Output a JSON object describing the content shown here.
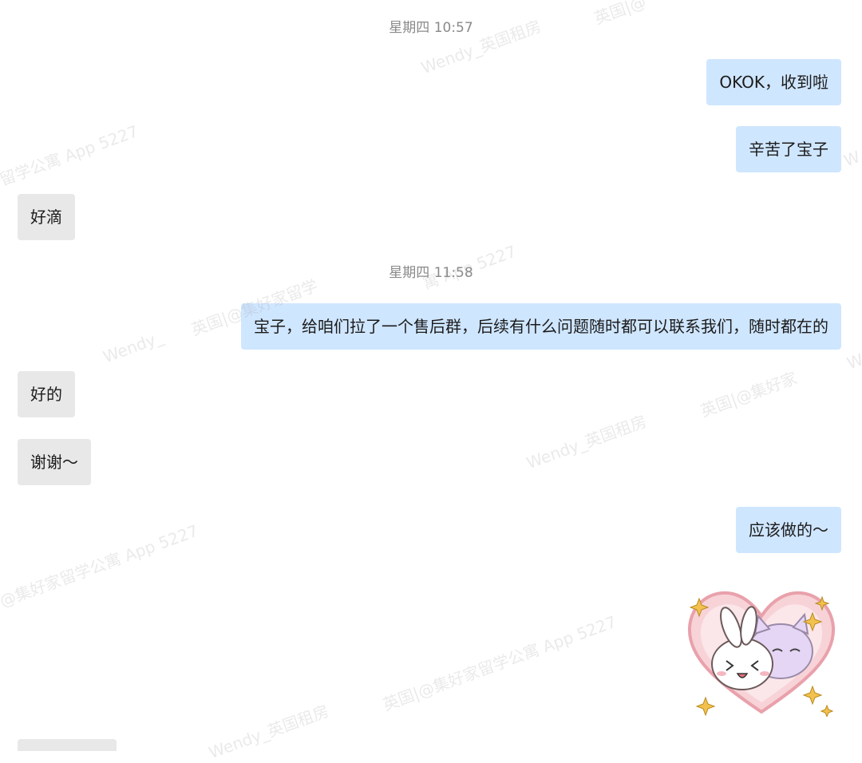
{
  "messages": {
    "ts1": "星期四 10:57",
    "m1": "OKOK，收到啦",
    "m2": "辛苦了宝子",
    "m3": "好滴",
    "ts2": "星期四 11:58",
    "m4": "宝子，给咱们拉了一个售后群，后续有什么问题随时都可以联系我们，随时都在的",
    "m5": "好的",
    "m6": "谢谢～",
    "m7": "应该做的～"
  },
  "watermarks": {
    "w1": "英国|@",
    "w2": "Wendy_英国租房",
    "w3": "留学公寓 App 5227",
    "w4": "寓 App 5227",
    "w5": "英国|@集好家留学",
    "w6": "Wendy_",
    "w7": "英国|@集好家",
    "w8": "Wendy_英国租房",
    "w9": "@集好家留学公寓 App 5227",
    "w10": "英国|@集好家留学公寓 App 5227",
    "w11": "Wendy_英国租房",
    "w12": "W",
    "w13": "W"
  },
  "colors": {
    "outgoing_bubble": "#cfe6ff",
    "incoming_bubble": "#e8e8e8",
    "timestamp": "#8a8a8a"
  },
  "sticker": {
    "icon": "heart-cats-sticker"
  }
}
